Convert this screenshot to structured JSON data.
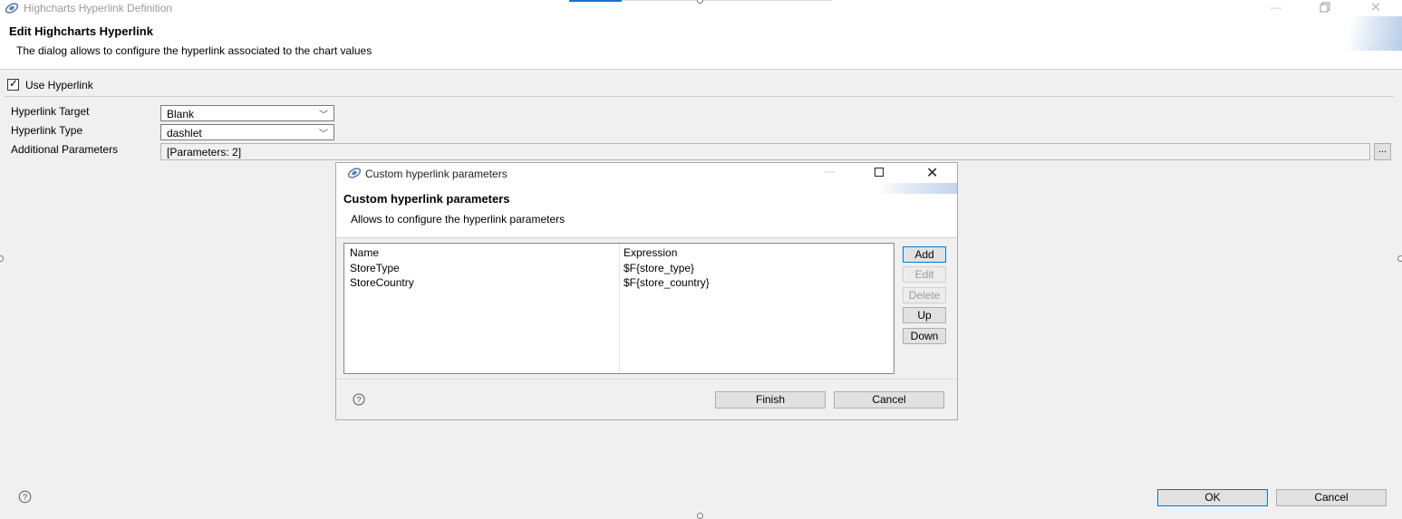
{
  "window": {
    "title": "Highcharts Hyperlink Definition",
    "header_title": "Edit Highcharts Hyperlink",
    "header_desc": "The dialog allows to configure the hyperlink associated to the chart values"
  },
  "form": {
    "use_hyperlink_label": "Use Hyperlink",
    "use_hyperlink_checked": true,
    "target_label": "Hyperlink Target",
    "target_value": "Blank",
    "type_label": "Hyperlink Type",
    "type_value": "dashlet",
    "params_label": "Additional Parameters",
    "params_value": "[Parameters: 2]",
    "ellipsis_label": "..."
  },
  "dialog": {
    "title": "Custom hyperlink parameters",
    "header_title": "Custom hyperlink parameters",
    "header_desc": "Allows to configure the hyperlink parameters",
    "columns": [
      "Name",
      "Expression"
    ],
    "rows": [
      {
        "name": "StoreType",
        "expression": "$F{store_type}"
      },
      {
        "name": "StoreCountry",
        "expression": "$F{store_country}"
      }
    ],
    "buttons": {
      "add": "Add",
      "edit": "Edit",
      "delete": "Delete",
      "up": "Up",
      "down": "Down"
    },
    "finish_label": "Finish",
    "cancel_label": "Cancel"
  },
  "footer": {
    "ok_label": "OK",
    "cancel_label": "Cancel"
  },
  "colors": {
    "accent": "#0078d7",
    "background": "#f0f0f0"
  },
  "icons": [
    "app-icon",
    "window-minimize-icon",
    "window-restore-icon",
    "window-close-icon",
    "checkbox-icon",
    "chevron-down-icon",
    "help-icon"
  ]
}
